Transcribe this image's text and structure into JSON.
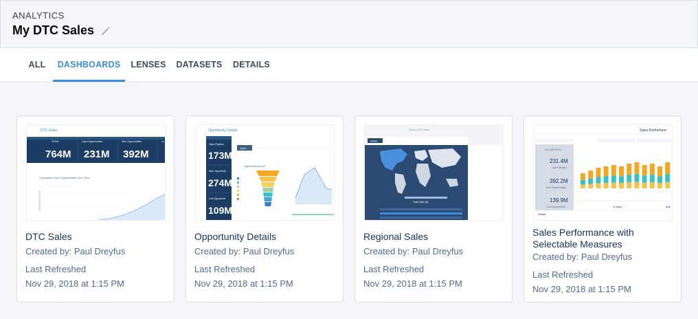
{
  "header": {
    "eyebrow": "ANALYTICS",
    "title": "My DTC Sales",
    "edit_icon": "pencil-icon"
  },
  "tabs": [
    {
      "label": "ALL",
      "active": false
    },
    {
      "label": "DASHBOARDS",
      "active": true
    },
    {
      "label": "LENSES",
      "active": false
    },
    {
      "label": "DATASETS",
      "active": false
    },
    {
      "label": "DETAILS",
      "active": false
    }
  ],
  "cards": [
    {
      "title": "DTC Sales",
      "created_by": "Created by: Paul Dreyfus",
      "refreshed_label": "Last Refreshed",
      "refreshed_date": "Nov 29, 2018 at 1:15 PM",
      "thumb": {
        "heading": "DTC Sales",
        "kpis": [
          {
            "label": "TOTAL",
            "value": "764M"
          },
          {
            "label": "Open Opportunities",
            "value": "231M"
          },
          {
            "label": "Won Opportunities",
            "value": "392M"
          },
          {
            "label": "Lo",
            "value": ""
          }
        ],
        "chart_caption": "Cumulative Won Opportunities Over Time"
      }
    },
    {
      "title": "Opportunity Details",
      "created_by": "Created by: Paul Dreyfus",
      "refreshed_label": "Last Refreshed",
      "refreshed_date": "Nov 29, 2018 at 1:15 PM",
      "thumb": {
        "heading": "Opportunity Details",
        "side_kpis": [
          {
            "label": "Open Pipeline",
            "value": "173M"
          },
          {
            "label": "Won Opportunit",
            "value": "274M"
          },
          {
            "label": "Lost Opportunit",
            "value": "109M"
          }
        ],
        "chip": "Open",
        "funnel_caption": "Opportunity Amount"
      }
    },
    {
      "title": "Regional Sales",
      "created_by": "Created by: Paul Dreyfus",
      "refreshed_label": "Last Refreshed",
      "refreshed_date": "Nov 29, 2018 at 1:15 PM",
      "thumb": {
        "top_caption": "← Back to DTC Sales",
        "map_label": "World",
        "legend_caption": "Total Sales ($)"
      }
    },
    {
      "title": "Sales Performance with Selectable Measures",
      "created_by": "Created by: Paul Dreyfus",
      "refreshed_label": "Last Refreshed",
      "refreshed_date": "Nov 29, 2018 at 1:15 PM",
      "thumb": {
        "heading": "Sales Performanc",
        "metrics_label": "KEY METRICS",
        "metrics": [
          {
            "value": "231.4M",
            "label": "Open Pipeline"
          },
          {
            "value": "392.2M",
            "label": "Won Opportunities"
          },
          {
            "value": "139.9M",
            "label": "Lost Opportunities"
          }
        ],
        "footer_left": "# Opps",
        "footer_right": "Avg",
        "details_label": "Details"
      }
    }
  ],
  "colors": {
    "accent": "#3d8dd9",
    "navy": "#16325c",
    "kpi_bg": "#1b3d63",
    "teal": "#37c1c8",
    "orange": "#f5a623",
    "map_bg": "#2b4b73"
  }
}
